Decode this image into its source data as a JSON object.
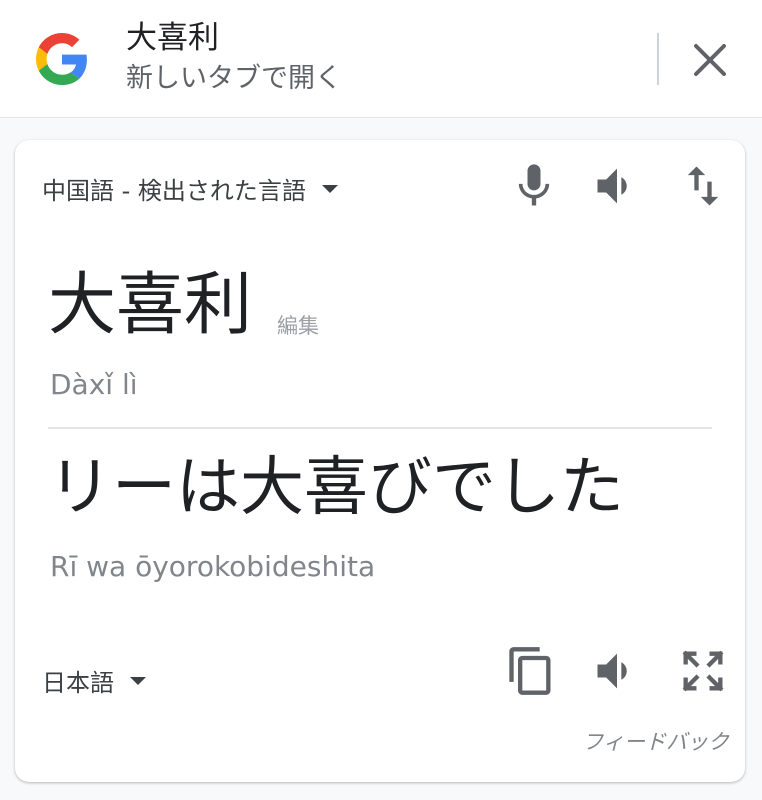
{
  "header": {
    "title": "大喜利",
    "subtitle": "新しいタブで開く",
    "logo_icon": "google-g-icon",
    "close_icon": "close-icon"
  },
  "card": {
    "source_language": "中国語 - 検出された言語",
    "source_text": "大喜利",
    "edit_label": "編集",
    "source_romanization": "Dàxǐ lì",
    "target_text": "リーは大喜びでした",
    "target_romanization": "Rī wa ōyorokobideshita",
    "target_language": "日本語",
    "feedback_label": "フィードバック",
    "source_icons": [
      "microphone-icon",
      "speaker-icon",
      "swap-languages-icon"
    ],
    "target_icons": [
      "copy-icon",
      "speaker-icon",
      "fullscreen-icon"
    ]
  },
  "colors": {
    "google_blue": "#4285F4",
    "google_red": "#EA4335",
    "google_yellow": "#FBBC05",
    "google_green": "#34A853",
    "icon_gray": "#5f6368",
    "muted_text": "#80868b"
  }
}
